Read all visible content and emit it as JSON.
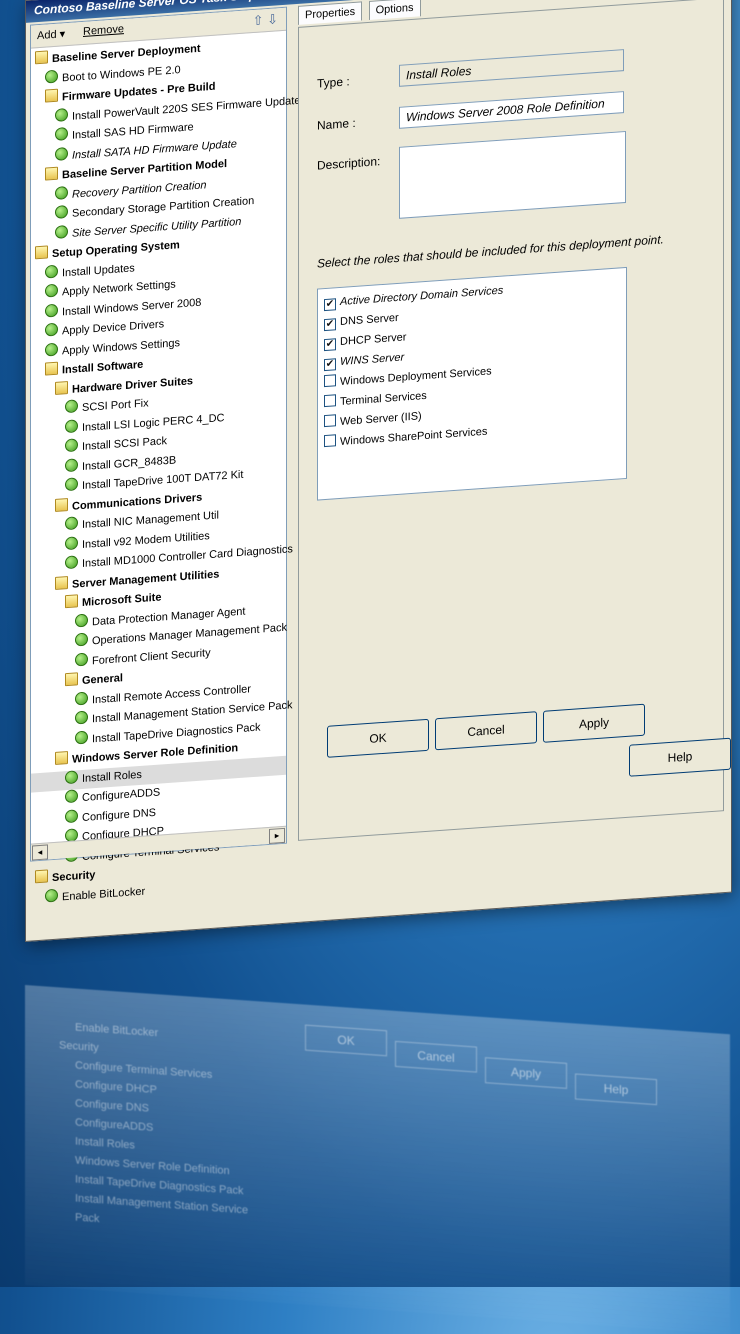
{
  "window": {
    "title": "Contoso Baseline Server OS Task Sequence Editor",
    "minimize": "_",
    "maximize": "□",
    "close": "x"
  },
  "toolbar": {
    "add": "Add ▾",
    "remove": "Remove"
  },
  "tree": [
    {
      "label": "Baseline Server Deployment",
      "depth": 0,
      "kind": "folder",
      "bold": true
    },
    {
      "label": "Boot to Windows PE 2.0",
      "depth": 1,
      "kind": "step"
    },
    {
      "label": "Firmware Updates - Pre Build",
      "depth": 1,
      "kind": "folder",
      "bold": true
    },
    {
      "label": "Install PowerVault 220S SES Firmware Update",
      "depth": 2,
      "kind": "step"
    },
    {
      "label": "Install SAS HD Firmware",
      "depth": 2,
      "kind": "step"
    },
    {
      "label": "Install SATA HD Firmware Update",
      "depth": 2,
      "kind": "step",
      "italic": true
    },
    {
      "label": "Baseline Server Partition Model",
      "depth": 1,
      "kind": "folder",
      "bold": true
    },
    {
      "label": "Recovery Partition Creation",
      "depth": 2,
      "kind": "step",
      "italic": true
    },
    {
      "label": "Secondary Storage Partition Creation",
      "depth": 2,
      "kind": "step"
    },
    {
      "label": "Site Server Specific Utility Partition",
      "depth": 2,
      "kind": "step",
      "italic": true
    },
    {
      "label": "Setup Operating System",
      "depth": 0,
      "kind": "folder",
      "bold": true
    },
    {
      "label": "Install Updates",
      "depth": 1,
      "kind": "step"
    },
    {
      "label": "Apply Network Settings",
      "depth": 1,
      "kind": "step"
    },
    {
      "label": "Install Windows Server 2008",
      "depth": 1,
      "kind": "step"
    },
    {
      "label": "Apply Device Drivers",
      "depth": 1,
      "kind": "step"
    },
    {
      "label": "Apply Windows Settings",
      "depth": 1,
      "kind": "step"
    },
    {
      "label": "Install Software",
      "depth": 1,
      "kind": "folder",
      "bold": true
    },
    {
      "label": "Hardware Driver Suites",
      "depth": 2,
      "kind": "folder",
      "bold": true
    },
    {
      "label": "SCSI Port Fix",
      "depth": 3,
      "kind": "step"
    },
    {
      "label": "Install LSI Logic PERC 4_DC",
      "depth": 3,
      "kind": "step"
    },
    {
      "label": "Install SCSI Pack",
      "depth": 3,
      "kind": "step"
    },
    {
      "label": "Install GCR_8483B",
      "depth": 3,
      "kind": "step"
    },
    {
      "label": "Install TapeDrive 100T DAT72 Kit",
      "depth": 3,
      "kind": "step"
    },
    {
      "label": "Communications Drivers",
      "depth": 2,
      "kind": "folder",
      "bold": true
    },
    {
      "label": "Install NIC Management Util",
      "depth": 3,
      "kind": "step"
    },
    {
      "label": "Install v92 Modem Utilities",
      "depth": 3,
      "kind": "step"
    },
    {
      "label": "Install MD1000 Controller Card Diagnostics",
      "depth": 3,
      "kind": "step"
    },
    {
      "label": "Server Management Utilities",
      "depth": 2,
      "kind": "folder",
      "bold": true
    },
    {
      "label": "Microsoft Suite",
      "depth": 3,
      "kind": "folder",
      "bold": true
    },
    {
      "label": "Data Protection Manager Agent",
      "depth": 4,
      "kind": "step"
    },
    {
      "label": "Operations Manager Management Pack",
      "depth": 4,
      "kind": "step"
    },
    {
      "label": "Forefront Client Security",
      "depth": 4,
      "kind": "step"
    },
    {
      "label": "General",
      "depth": 3,
      "kind": "folder",
      "bold": true
    },
    {
      "label": "Install Remote Access Controller",
      "depth": 4,
      "kind": "step"
    },
    {
      "label": "Install Management Station Service Pack",
      "depth": 4,
      "kind": "step"
    },
    {
      "label": "Install TapeDrive Diagnostics Pack",
      "depth": 4,
      "kind": "step"
    },
    {
      "label": "Windows Server Role Definition",
      "depth": 2,
      "kind": "folder",
      "bold": true
    },
    {
      "label": "Install Roles",
      "depth": 3,
      "kind": "step",
      "selected": true
    },
    {
      "label": "ConfigureADDS",
      "depth": 3,
      "kind": "step"
    },
    {
      "label": "Configure DNS",
      "depth": 3,
      "kind": "step"
    },
    {
      "label": "Configure DHCP",
      "depth": 3,
      "kind": "step"
    },
    {
      "label": "Configure Terminal Services",
      "depth": 3,
      "kind": "step"
    },
    {
      "label": "Security",
      "depth": 0,
      "kind": "folder",
      "bold": true
    },
    {
      "label": "Enable BitLocker",
      "depth": 1,
      "kind": "step"
    }
  ],
  "tabs": [
    "Properties",
    "Options"
  ],
  "properties": {
    "type_label": "Type :",
    "type_value": "Install Roles",
    "name_label": "Name :",
    "name_value": "Windows Server 2008 Role Definition",
    "description_label": "Description:",
    "description_value": "",
    "instruction": "Select the roles that should be included for this deployment point."
  },
  "roles": [
    {
      "label": "Active Directory Domain Services",
      "checked": true,
      "italic": true
    },
    {
      "label": "DNS Server",
      "checked": true
    },
    {
      "label": "DHCP Server",
      "checked": true
    },
    {
      "label": "WINS Server",
      "checked": true,
      "italic": true
    },
    {
      "label": "Windows Deployment Services",
      "checked": false
    },
    {
      "label": "Terminal Services",
      "checked": false
    },
    {
      "label": "Web Server (IIS)",
      "checked": false
    },
    {
      "label": "Windows SharePoint Services",
      "checked": false
    }
  ],
  "buttons": {
    "ok": "OK",
    "cancel": "Cancel",
    "apply": "Apply",
    "help": "Help"
  },
  "scroll": {
    "left": "◂",
    "right": "▸"
  },
  "reflection": {
    "ok": "OK",
    "cancel": "Cancel",
    "apply": "Apply",
    "help": "Help",
    "items": [
      "Enable BitLocker",
      "Security",
      "Configure Terminal Services",
      "Configure DHCP",
      "Configure DNS",
      "ConfigureADDS",
      "Install Roles",
      "Windows Server Role Definition",
      "Install TapeDrive Diagnostics Pack",
      "Install Management Station Service Pack"
    ]
  }
}
